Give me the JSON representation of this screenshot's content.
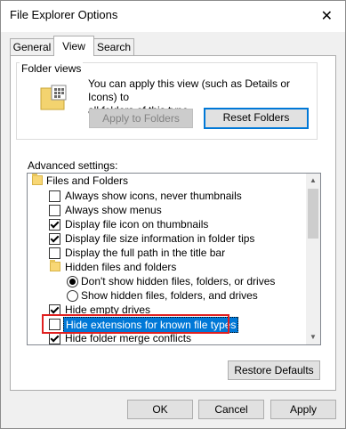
{
  "window": {
    "title": "File Explorer Options",
    "close_glyph": "✕"
  },
  "tabs": [
    {
      "label": "General",
      "active": false
    },
    {
      "label": "View",
      "active": true
    },
    {
      "label": "Search",
      "active": false
    }
  ],
  "folder_views": {
    "label": "Folder views",
    "description": "You can apply this view (such as Details or Icons) to all of this type.",
    "description_lines": [
      "You can apply this view (such as Details or Icons) to",
      "all folders of this type."
    ],
    "apply_button": "Apply to Folders",
    "reset_button": "Reset Folders"
  },
  "advanced": {
    "label": "Advanced settings:",
    "items": [
      {
        "type": "folder",
        "label": "Files and Folders"
      },
      {
        "type": "checkbox",
        "label": "Always show icons, never thumbnails",
        "checked": false
      },
      {
        "type": "checkbox",
        "label": "Always show menus",
        "checked": false
      },
      {
        "type": "checkbox",
        "label": "Display file icon on thumbnails",
        "checked": true
      },
      {
        "type": "checkbox",
        "label": "Display file size information in folder tips",
        "checked": true
      },
      {
        "type": "checkbox",
        "label": "Display the full path in the title bar",
        "checked": false
      },
      {
        "type": "folder",
        "label": "Hidden files and folders"
      },
      {
        "type": "radio",
        "label": "Don't show hidden files, folders, or drives",
        "checked": true
      },
      {
        "type": "radio",
        "label": "Show hidden files, folders, and drives",
        "checked": false
      },
      {
        "type": "checkbox",
        "label": "Hide empty drives",
        "checked": true
      },
      {
        "type": "checkbox",
        "label": "Hide extensions for known file types",
        "checked": false,
        "selected": true
      },
      {
        "type": "checkbox",
        "label": "Hide folder merge conflicts",
        "checked": true
      }
    ],
    "restore_button": "Restore Defaults"
  },
  "footer": {
    "ok": "OK",
    "cancel": "Cancel",
    "apply": "Apply"
  },
  "colors": {
    "highlight_box": "#e02020",
    "selection": "#0078d7",
    "folder": "#f8d775"
  }
}
